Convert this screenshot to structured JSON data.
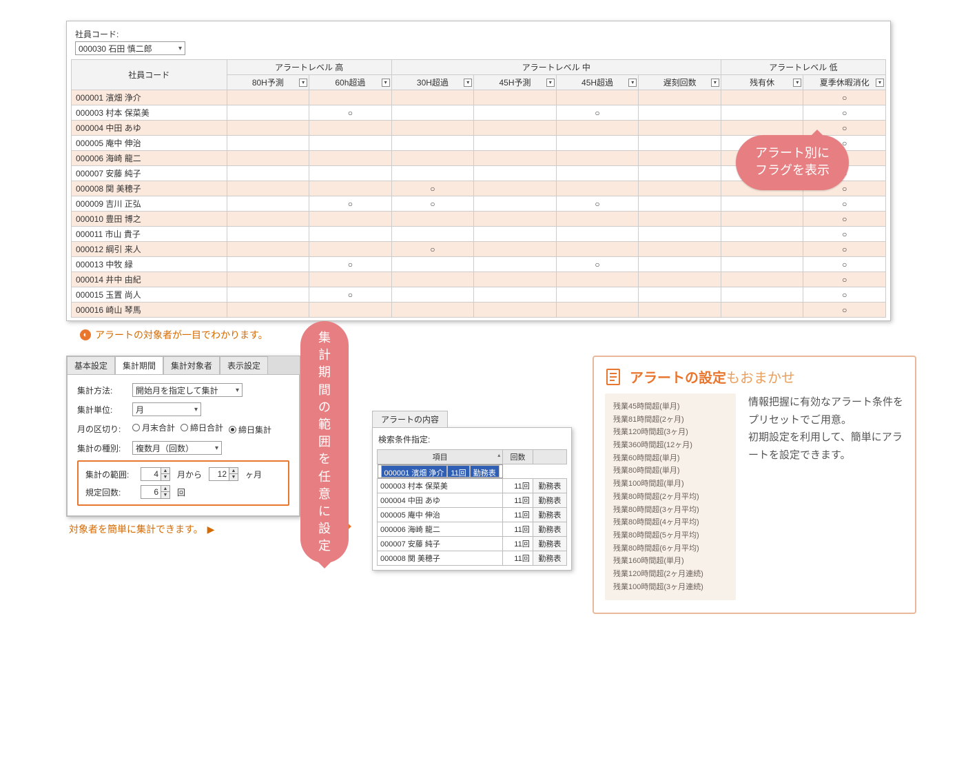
{
  "top": {
    "employee_code_label": "社員コード:",
    "employee_select_value": "000030 石田 慎二郎",
    "header": {
      "emp": "社員コード",
      "group_high": "アラートレベル 高",
      "group_mid": "アラートレベル 中",
      "group_low": "アラートレベル 低",
      "cols": [
        "80H予測",
        "60h超過",
        "30H超過",
        "45H予測",
        "45H超過",
        "遅刻回数",
        "残有休",
        "夏季休暇消化"
      ]
    },
    "rows": [
      {
        "name": "000001 濱畑 浄介",
        "marks": [
          "",
          "",
          "",
          "",
          "",
          "",
          "",
          "○"
        ]
      },
      {
        "name": "000003 村本 保菜美",
        "marks": [
          "",
          "○",
          "",
          "",
          "○",
          "",
          "",
          "○"
        ]
      },
      {
        "name": "000004 中田 あゆ",
        "marks": [
          "",
          "",
          "",
          "",
          "",
          "",
          "",
          "○"
        ]
      },
      {
        "name": "000005 庵中 伸治",
        "marks": [
          "",
          "",
          "",
          "",
          "",
          "",
          "",
          "○"
        ]
      },
      {
        "name": "000006 海崎 龍二",
        "marks": [
          "",
          "",
          "",
          "",
          "",
          "",
          "",
          "○"
        ]
      },
      {
        "name": "000007 安藤 純子",
        "marks": [
          "",
          "",
          "",
          "",
          "",
          "",
          "",
          "○"
        ]
      },
      {
        "name": "000008 関 美穂子",
        "marks": [
          "",
          "",
          "○",
          "",
          "",
          "",
          "",
          "○"
        ]
      },
      {
        "name": "000009 吉川 正弘",
        "marks": [
          "",
          "○",
          "○",
          "",
          "○",
          "",
          "",
          "○"
        ]
      },
      {
        "name": "000010 豊田 博之",
        "marks": [
          "",
          "",
          "",
          "",
          "",
          "",
          "",
          "○"
        ]
      },
      {
        "name": "000011 市山 貴子",
        "marks": [
          "",
          "",
          "",
          "",
          "",
          "",
          "",
          "○"
        ]
      },
      {
        "name": "000012 綱引 来人",
        "marks": [
          "",
          "",
          "○",
          "",
          "",
          "",
          "",
          "○"
        ]
      },
      {
        "name": "000013 中牧 緑",
        "marks": [
          "",
          "○",
          "",
          "",
          "○",
          "",
          "",
          "○"
        ]
      },
      {
        "name": "000014 井中 由紀",
        "marks": [
          "",
          "",
          "",
          "",
          "",
          "",
          "",
          "○"
        ]
      },
      {
        "name": "000015 玉置 尚人",
        "marks": [
          "",
          "○",
          "",
          "",
          "",
          "",
          "",
          "○"
        ]
      },
      {
        "name": "000016 崎山 琴馬",
        "marks": [
          "",
          "",
          "",
          "",
          "",
          "",
          "",
          "○"
        ]
      }
    ],
    "balloon_l1": "アラート別に",
    "balloon_l2": "フラグを表示",
    "caption": "アラートの対象者が一目でわかります。"
  },
  "settings": {
    "tabs": [
      "基本設定",
      "集計期間",
      "集計対象者",
      "表示設定"
    ],
    "active_tab": 1,
    "method_label": "集計方法:",
    "method_value": "開始月を指定して集計",
    "unit_label": "集計単位:",
    "unit_value": "月",
    "divider_label": "月の区切り:",
    "radios": [
      "月末合計",
      "締日合計",
      "締日集計"
    ],
    "radio_selected": 2,
    "kind_label": "集計の種別:",
    "kind_value": "複数月（回数）",
    "range_label": "集計の範囲:",
    "range_from": "4",
    "range_from_suffix": "月から",
    "range_to": "12",
    "range_to_suffix": "ヶ月",
    "count_label": "規定回数:",
    "count_value": "6",
    "count_suffix": "回",
    "balloon_l1": "集計期間の範囲を",
    "balloon_l2": "任意に設定",
    "caption": "対象者を簡単に集計できます。"
  },
  "content": {
    "panel_title": "アラートの内容",
    "criteria_label": "検索条件指定:",
    "cols": [
      "項目",
      "回数",
      ""
    ],
    "btn_label": "勤務表",
    "count_suffix": "回",
    "rows": [
      {
        "name": "000001 濱畑 浄介",
        "count": "11",
        "selected": true
      },
      {
        "name": "000003 村本 保菜美",
        "count": "11"
      },
      {
        "name": "000004 中田 あゆ",
        "count": "11"
      },
      {
        "name": "000005 庵中 伸治",
        "count": "11"
      },
      {
        "name": "000006 海崎 龍二",
        "count": "11"
      },
      {
        "name": "000007 安藤 純子",
        "count": "11"
      },
      {
        "name": "000008 関 美穂子",
        "count": "11"
      }
    ]
  },
  "preset": {
    "title_bold": "アラートの設定",
    "title_rest": "もおまかせ",
    "items": [
      "残業45時間超(単月)",
      "残業81時間超(2ヶ月)",
      "残業120時間超(3ヶ月)",
      "残業360時間超(12ヶ月)",
      "残業60時間超(単月)",
      "残業80時間超(単月)",
      "残業100時間超(単月)",
      "残業80時間超(2ヶ月平均)",
      "残業80時間超(3ヶ月平均)",
      "残業80時間超(4ヶ月平均)",
      "残業80時間超(5ヶ月平均)",
      "残業80時間超(6ヶ月平均)",
      "残業160時間超(単月)",
      "残業120時間超(2ヶ月連続)",
      "残業100時間超(3ヶ月連続)"
    ],
    "desc": "情報把握に有効なアラート条件をプリセットでご用意。\n初期設定を利用して、簡単にアラートを設定できます。"
  }
}
